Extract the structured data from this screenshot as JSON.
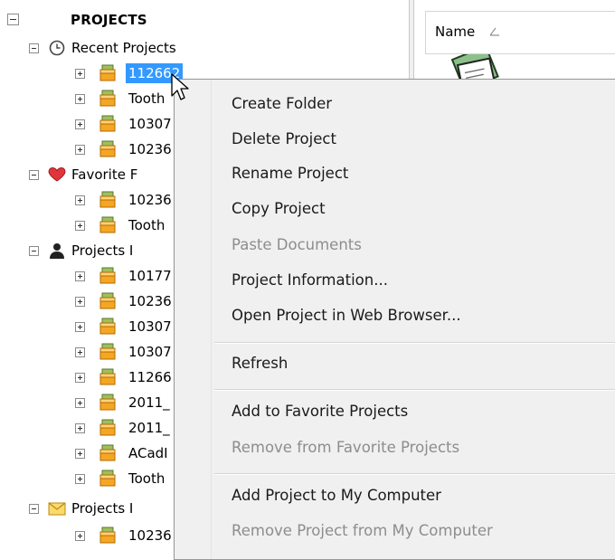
{
  "tree": {
    "root": {
      "label": "PROJECTS"
    },
    "groups": [
      {
        "id": "recent",
        "label": "Recent Projects",
        "icon": "clock-icon",
        "items": [
          "112662",
          "Tooth",
          "10307",
          "10236"
        ]
      },
      {
        "id": "favorite",
        "label": "Favorite F",
        "icon": "heart-icon",
        "items": [
          "10236",
          "Tooth"
        ]
      },
      {
        "id": "projects-i",
        "label": "Projects I",
        "icon": "person-icon",
        "items": [
          "10177",
          "10236",
          "10307",
          "10307",
          "11266",
          "2011_",
          "2011_",
          "ACadI",
          "Tooth"
        ]
      },
      {
        "id": "projects-i-mail",
        "label": "Projects I",
        "icon": "envelope-icon",
        "items": [
          "10236"
        ]
      }
    ],
    "selected_item": "112662"
  },
  "right_pane": {
    "column_header": "Name"
  },
  "context_menu": {
    "items": [
      {
        "label": "Create Folder",
        "enabled": true
      },
      {
        "label": "Delete Project",
        "enabled": true
      },
      {
        "label": "Rename Project",
        "enabled": true
      },
      {
        "label": "Copy Project",
        "enabled": true
      },
      {
        "label": "Paste Documents",
        "enabled": false
      },
      {
        "label": "Project Information...",
        "enabled": true
      },
      {
        "label": "Open Project in Web Browser...",
        "enabled": true
      },
      {
        "label": "Refresh",
        "enabled": true
      },
      {
        "label": "Add to Favorite Projects",
        "enabled": true
      },
      {
        "label": "Remove from Favorite Projects",
        "enabled": false
      },
      {
        "label": "Add Project to My Computer",
        "enabled": true
      },
      {
        "label": "Remove Project from My Computer",
        "enabled": false
      }
    ]
  },
  "colors": {
    "selection": "#3399ff",
    "menu_background": "#f0f0f0",
    "disabled_text": "#8d8d8d",
    "folder_orange": "#f5a623"
  }
}
